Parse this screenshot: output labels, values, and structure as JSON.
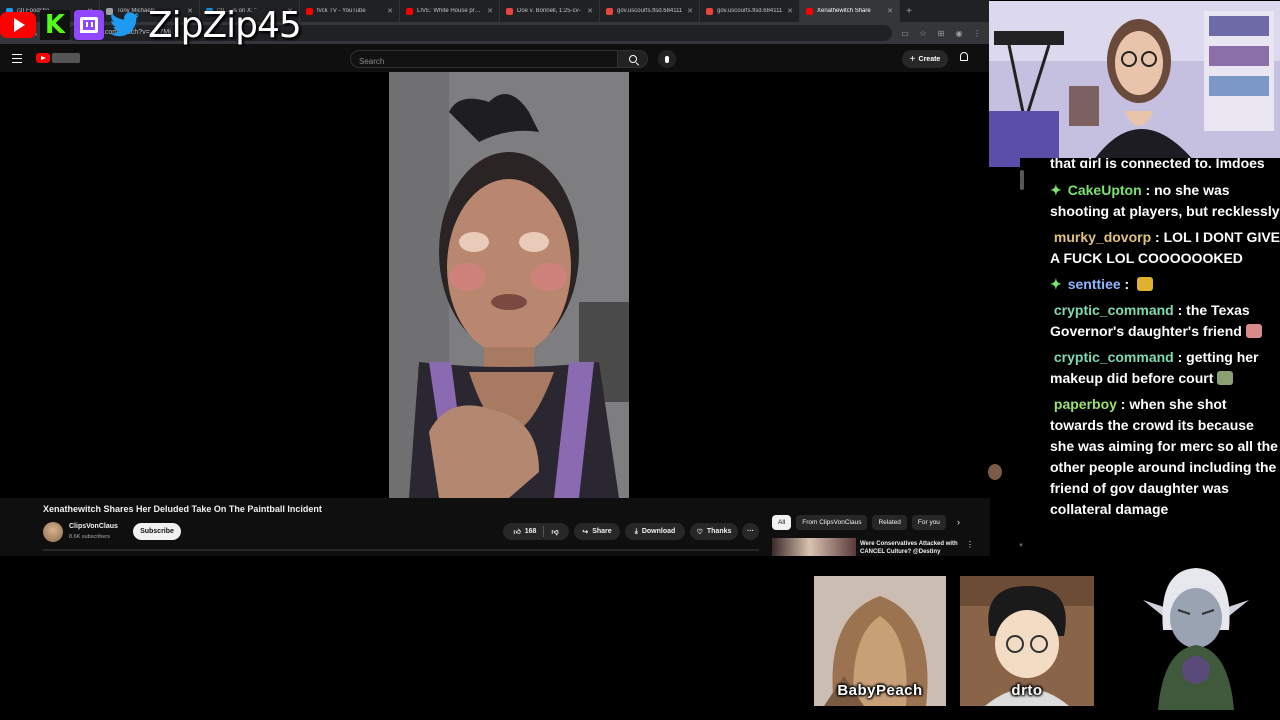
{
  "browser": {
    "tabs": [
      {
        "label": "(3) Foodsho",
        "color": "#1d9bf0"
      },
      {
        "label": "Tony Michaels",
        "color": "#9aa0a6"
      },
      {
        "label": "(3) ... is on X: \"",
        "color": "#1d9bf0"
      },
      {
        "label": "fvck TV - YouTube",
        "color": "#ff0000"
      },
      {
        "label": "LIVE: White House press",
        "color": "#ff0000"
      },
      {
        "label": "Doe v. Bonnell, 1:25-cv-",
        "color": "#e8453c"
      },
      {
        "label": "gov.uscourts.flsd.684111",
        "color": "#e8453c"
      },
      {
        "label": "gov.uscourts.flsd.684111",
        "color": "#e8453c"
      },
      {
        "label": "Xenathewitch Share",
        "color": "#ff0000"
      }
    ],
    "url": "youtube.com/watch?v=...17Mi"
  },
  "overlay": {
    "streamer_name": "ZipZip45",
    "kick_letter": "K"
  },
  "youtube": {
    "search_placeholder": "Search",
    "create_label": "Create",
    "video": {
      "title": "Xenathewitch Shares Her Deluded Take On The Paintball Incident",
      "channel": "ClipsVonClaus",
      "subscribers": "8.6K subscribers",
      "subscribe_label": "Subscribe",
      "likes": "168",
      "share_label": "Share",
      "download_label": "Download",
      "thanks_label": "Thanks",
      "more": "···"
    },
    "chips": [
      "All",
      "From ClipsVonClaus",
      "Related",
      "For you"
    ],
    "recommended": {
      "title": "Were Conservatives Attacked with CANCEL Culture? @Destiny"
    }
  },
  "chat": {
    "partial_top": "that girl is connected to. Imdoes",
    "messages": [
      {
        "user": "CakeUpton",
        "badge": true,
        "color": "#7be36d",
        "text": "no she was shooting at players, but recklessly"
      },
      {
        "user": "murky_dovorp",
        "badge": false,
        "color": "#e0c27a",
        "text": "LOL I DONT GIVE A FUCK LOL COOOOOOKED"
      },
      {
        "user": "senttiee",
        "badge": true,
        "color": "#8fb6ff",
        "text": "",
        "emote": "#e0b030"
      },
      {
        "user": "cryptic_command",
        "badge": false,
        "color": "#7fd9b0",
        "text": "the Texas Governor's daughter's friend",
        "emote": "#d98a8a"
      },
      {
        "user": "cryptic_command",
        "badge": false,
        "color": "#7fd9b0",
        "text": "getting her makeup did before court",
        "emote": "#8aa070"
      },
      {
        "user": "paperboy",
        "badge": false,
        "color": "#9be36d",
        "text": "when she shot towards the crowd its because she was aiming for merc so all the other people around including the friend of gov daughter was collateral damage"
      }
    ]
  },
  "avatars": {
    "left_label": "BabyPeach",
    "right_label": "drto"
  }
}
